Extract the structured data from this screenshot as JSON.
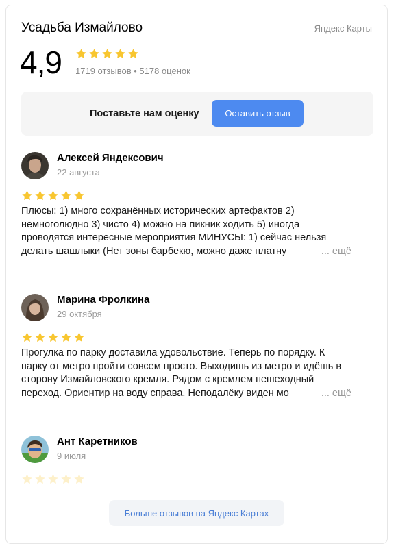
{
  "header": {
    "title": "Усадьба Измайлово",
    "brand": "Яндекс Карты",
    "rating": "4,9",
    "stars": 5,
    "counts": "1719 отзывов • 5178 оценок"
  },
  "cta": {
    "text": "Поставьте нам оценку",
    "button": "Оставить отзыв"
  },
  "reviews": [
    {
      "author": "Алексей Яндексович",
      "date": "22 августа",
      "stars": 5,
      "text": "Плюсы: 1) много сохранённых исторических артефактов 2) немноголюдно 3) чисто 4) можно на пикник ходить 5) иногда проводятся интересные мероприятия МИНУСЫ: 1) сейчас нельзя делать шашлыки (Нет зоны барбекю, можно даже платну",
      "more": "... ещё"
    },
    {
      "author": "Марина Фролкина",
      "date": "29 октября",
      "stars": 5,
      "text": "Прогулка по парку доставила удовольствие. Теперь по порядку. К парку от метро пройти совсем просто. Выходишь из метро и идёшь в сторону Измайловского кремля. Рядом с кремлем пешеходный переход. Ориентир на воду справа. Неподалёку виден мо",
      "more": "... ещё"
    },
    {
      "author": "Ант Каретников",
      "date": "9 июля",
      "stars": 5
    }
  ],
  "footer": {
    "more_link": "Больше отзывов на Яндекс Картах"
  },
  "colors": {
    "star": "#f8c630",
    "accent": "#4d8af0",
    "link": "#4b7fd6"
  }
}
